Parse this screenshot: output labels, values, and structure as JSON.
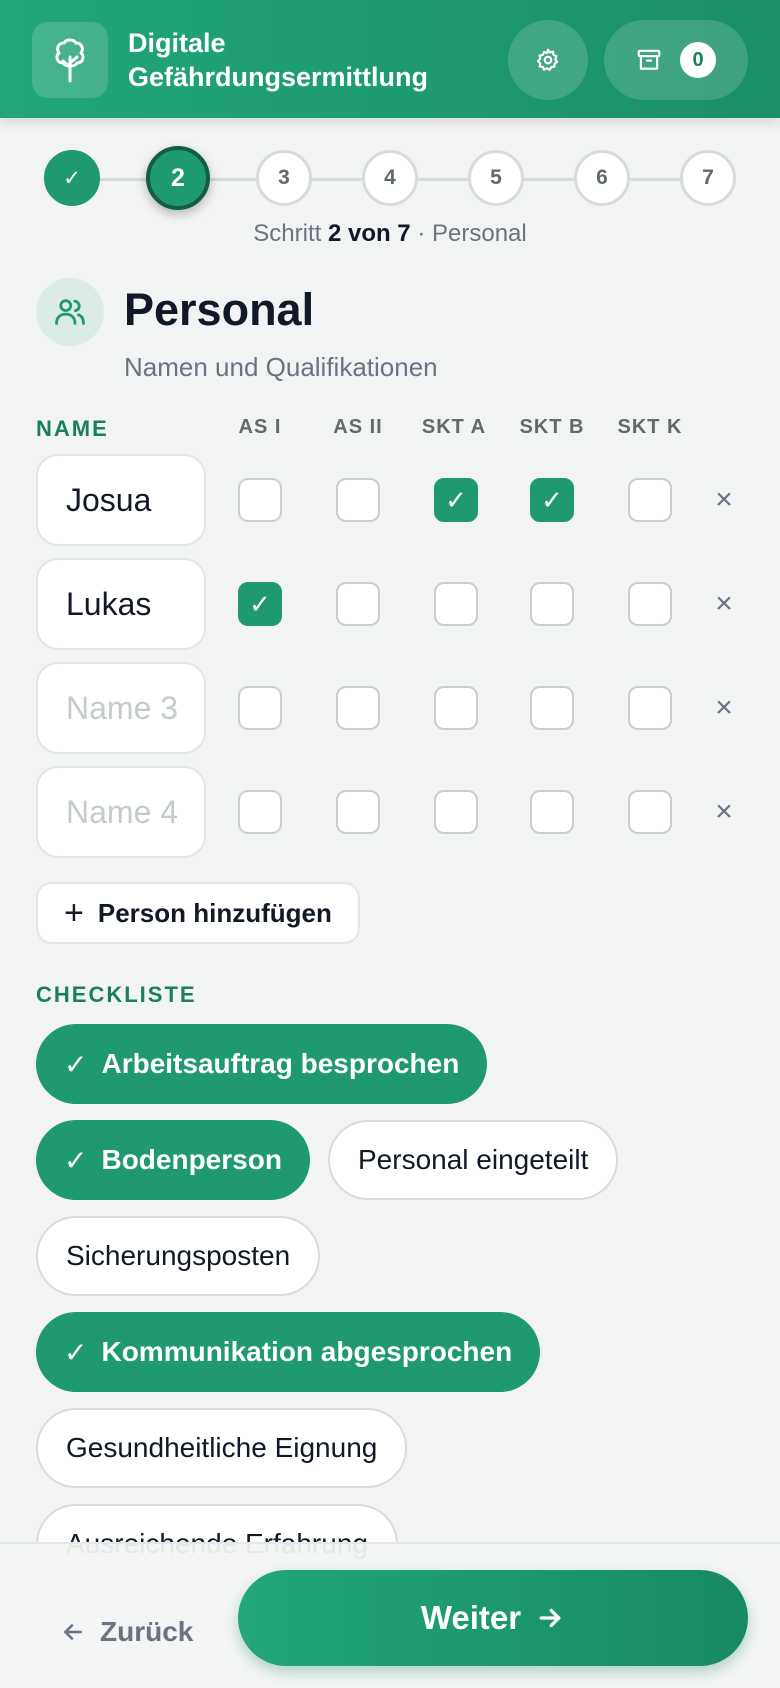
{
  "header": {
    "title": "Digitale Gefährdungsermittlung",
    "archive_count": "0"
  },
  "stepper": {
    "steps": [
      {
        "label": "✓",
        "state": "done"
      },
      {
        "label": "2",
        "state": "active"
      },
      {
        "label": "3",
        "state": "todo"
      },
      {
        "label": "4",
        "state": "todo"
      },
      {
        "label": "5",
        "state": "todo"
      },
      {
        "label": "6",
        "state": "todo"
      },
      {
        "label": "7",
        "state": "todo"
      }
    ],
    "caption_prefix": "Schritt",
    "caption_current": "2 von 7",
    "caption_sep": "·",
    "caption_name": "Personal"
  },
  "section": {
    "icon": "users-icon",
    "title": "Personal",
    "subtitle": "Namen und Qualifikationen"
  },
  "table": {
    "headers": [
      "NAME",
      "AS I",
      "AS II",
      "SKT A",
      "SKT B",
      "SKT K"
    ],
    "rows": [
      {
        "value": "Josua",
        "placeholder": "",
        "checks": [
          false,
          false,
          true,
          true,
          false
        ]
      },
      {
        "value": "Lukas",
        "placeholder": "",
        "checks": [
          true,
          false,
          false,
          false,
          false
        ]
      },
      {
        "value": "",
        "placeholder": "Name 3",
        "checks": [
          false,
          false,
          false,
          false,
          false
        ]
      },
      {
        "value": "",
        "placeholder": "Name 4",
        "checks": [
          false,
          false,
          false,
          false,
          false
        ]
      }
    ],
    "remove_label": "×"
  },
  "add_person": {
    "icon": "plus-icon",
    "label": "Person hinzufügen"
  },
  "checklist": {
    "heading": "CHECKLISTE",
    "items": [
      {
        "label": "Arbeitsauftrag besprochen",
        "checked": true
      },
      {
        "label": "Bodenperson",
        "checked": true
      },
      {
        "label": "Personal eingeteilt",
        "checked": false
      },
      {
        "label": "Sicherungsposten",
        "checked": false
      },
      {
        "label": "Kommunikation abgesprochen",
        "checked": true
      },
      {
        "label": "Gesundheitliche Eignung",
        "checked": false
      },
      {
        "label": "Ausreichende Erfahrung",
        "checked": false
      }
    ]
  },
  "footer": {
    "back_label": "Zurück",
    "next_label": "Weiter"
  },
  "colors": {
    "brand": "#1f9a70",
    "brand_dark": "#135c45"
  }
}
